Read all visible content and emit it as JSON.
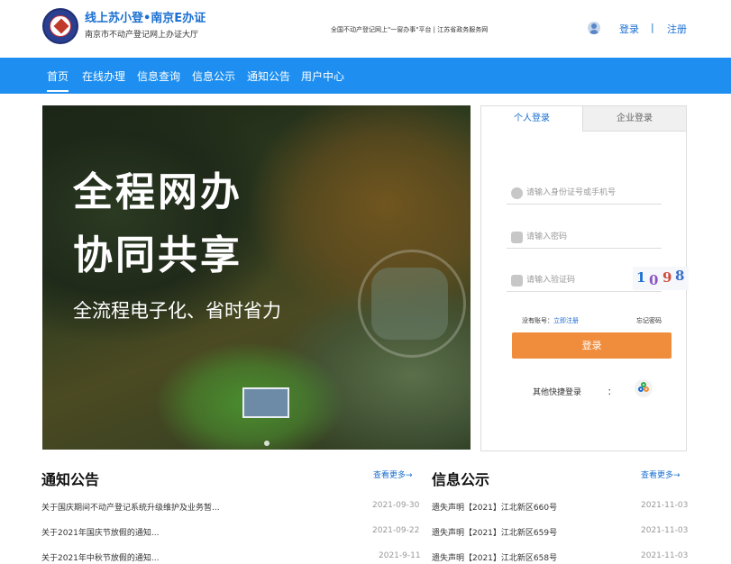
{
  "header": {
    "title": "线上苏小登•南京E办证",
    "subtitle": "南京市不动产登记网上办证大厅",
    "slogan": "全国不动产登记网上\"一窗办事\"平台 | 江苏省政务服务网",
    "login": "登录",
    "separator": "|",
    "register": "注册"
  },
  "nav": {
    "items": [
      "首页",
      "在线办理",
      "信息查询",
      "信息公示",
      "通知公告",
      "用户中心"
    ]
  },
  "banner": {
    "line1": "全程网办",
    "line2": "协同共享",
    "line3": "全流程电子化、省时省力"
  },
  "login_panel": {
    "tabs": [
      "个人登录",
      "企业登录"
    ],
    "id_placeholder": "请输入身份证号或手机号",
    "password_placeholder": "请输入密码",
    "captcha_placeholder": "请输入验证码",
    "captcha_chars": [
      "1",
      "0",
      "9",
      "8"
    ],
    "no_account": "没有账号：",
    "register_now": "立即注册",
    "forgot": "忘记密码",
    "submit": "登录",
    "other_login": "其他快捷登录",
    "colon": "："
  },
  "notice": {
    "title": "通知公告",
    "more": "查看更多→",
    "items": [
      {
        "text": "关于国庆期间不动产登记系统升级维护及业务暂...",
        "date": "2021-09-30"
      },
      {
        "text": "关于2021年国庆节放假的通知...",
        "date": "2021-09-22"
      },
      {
        "text": "关于2021年中秋节放假的通知...",
        "date": "2021-9-11"
      }
    ]
  },
  "publicity": {
    "title": "信息公示",
    "more": "查看更多→",
    "items": [
      {
        "text": "遗失声明【2021】江北新区660号",
        "date": "2021-11-03"
      },
      {
        "text": "遗失声明【2021】江北新区659号",
        "date": "2021-11-03"
      },
      {
        "text": "遗失声明【2021】江北新区658号",
        "date": "2021-11-03"
      }
    ]
  },
  "colors": {
    "brand_blue": "#1e8ff0",
    "link_blue": "#1a6fd1",
    "login_orange": "#f08d3d"
  }
}
